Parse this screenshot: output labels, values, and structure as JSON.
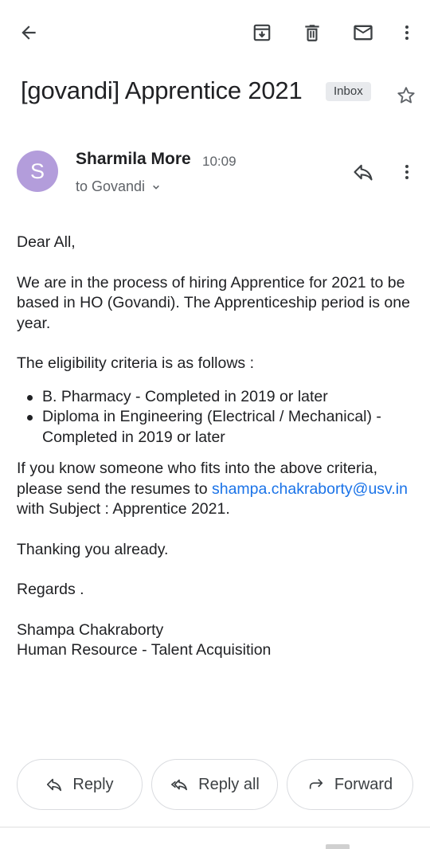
{
  "toolbar": {
    "back_icon": "arrow-back-icon",
    "archive_icon": "archive-icon",
    "delete_icon": "trash-icon",
    "mark_unread_icon": "mail-icon",
    "more_icon": "more-vert-icon"
  },
  "email": {
    "subject": "[govandi] Apprentice 2021",
    "label": "Inbox",
    "sender_initial": "S",
    "sender_name": "Sharmila More",
    "time": "10:09",
    "recipient": "to Govandi",
    "body": {
      "greeting": "Dear All,",
      "paragraph1": "We are in the process of hiring  Apprentice for 2021 to be based in HO (Govandi). The Apprenticeship period is one year.",
      "paragraph2": "The eligibility criteria is as follows :",
      "criteria": [
        "B. Pharmacy - Completed in 2019 or later",
        "Diploma in Engineering (Electrical / Mechanical) - Completed in 2019 or later"
      ],
      "paragraph3_before": "If you know someone who fits into the above criteria, please send the resumes to ",
      "email_link": "shampa.chakraborty@usv.in",
      "paragraph3_after": " with Subject : Apprentice 2021.",
      "thanks": "Thanking you already.",
      "regards": "Regards .",
      "signature_name": "Shampa Chakraborty",
      "signature_title": "Human Resource - Talent Acquisition"
    }
  },
  "actions": {
    "reply": "Reply",
    "reply_all": "Reply all",
    "forward": "Forward"
  },
  "colors": {
    "avatar": "#b39ddb",
    "link": "#1a73e8",
    "chip": "#e8eaed"
  }
}
